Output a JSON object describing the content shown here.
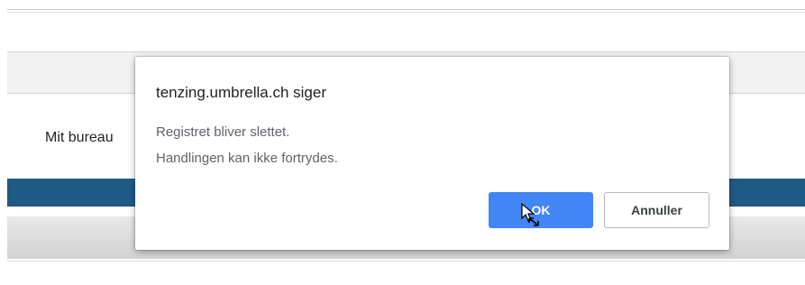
{
  "page": {
    "bureau_label": "Mit bureau"
  },
  "dialog": {
    "title": "tenzing.umbrella.ch siger",
    "message_line1": "Registret bliver slettet.",
    "message_line2": "Handlingen kan ikke fortrydes.",
    "ok_label": "OK",
    "cancel_label": "Annuller"
  },
  "colors": {
    "accent_blue_bar": "#1f5a85",
    "ok_button": "#4285f4"
  },
  "cursor": {
    "icon": "move-cursor-icon"
  }
}
